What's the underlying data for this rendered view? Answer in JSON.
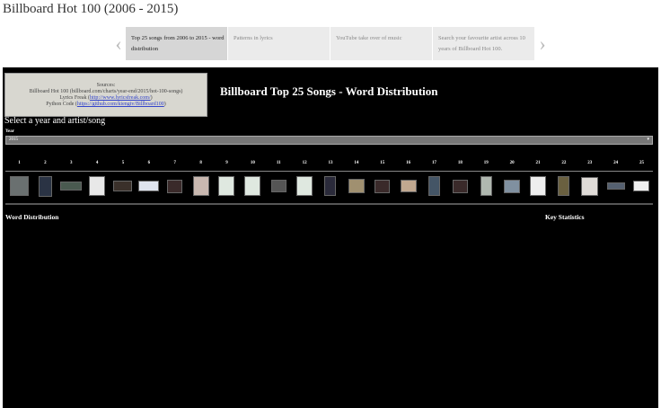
{
  "page_title": "Billboard Hot 100 (2006 - 2015)",
  "carousel": {
    "slides": [
      "Top 25 songs from 2006 to 2015 - word distribution",
      "Patterns in lyrics",
      "YouTube take over of music",
      "Search your favourite artist across 10 years of Billboard Hot 100."
    ]
  },
  "sources": {
    "label": "Sources:",
    "billboard": "Billboard Hot 100 (billboard.com/charts/year-end/2015/hot-100-songs)",
    "lyrics_prefix": "Lyrics Freak (",
    "lyrics_link": "http://www.lyricsfreak.com/",
    "python_prefix": "Python Code (",
    "python_link": "https://github.com/kiengiv/Billboard100",
    "close": ")"
  },
  "heading": "Billboard Top 25 Songs - Word Distribution",
  "select_prompt": "Select a year and artist/song",
  "year": {
    "label": "Year",
    "value": "2015"
  },
  "ranks": [
    "1",
    "2",
    "3",
    "4",
    "5",
    "6",
    "7",
    "8",
    "9",
    "10",
    "11",
    "12",
    "13",
    "14",
    "15",
    "16",
    "17",
    "18",
    "19",
    "20",
    "21",
    "22",
    "23",
    "24",
    "25"
  ],
  "thumb_colors": [
    "#6a7070",
    "#2a3344",
    "#4a5a50",
    "#e8e8e8",
    "#3a302a",
    "#dfe4ee",
    "#3a2a2a",
    "#c9b8b0",
    "#dfe8e0",
    "#dfe8e0",
    "#555",
    "#dfe8e0",
    "#2a2a3a",
    "#a09070",
    "#3a2a2a",
    "#c0a890",
    "#445566",
    "#3a2a2a",
    "#b0b8b0",
    "#8090a0",
    "#eeeeee",
    "#6a6040",
    "#e0dcd8",
    "#556070",
    "#f0f0f0"
  ],
  "sections": {
    "word_distribution": "Word Distribution",
    "key_statistics": "Key Statistics"
  }
}
